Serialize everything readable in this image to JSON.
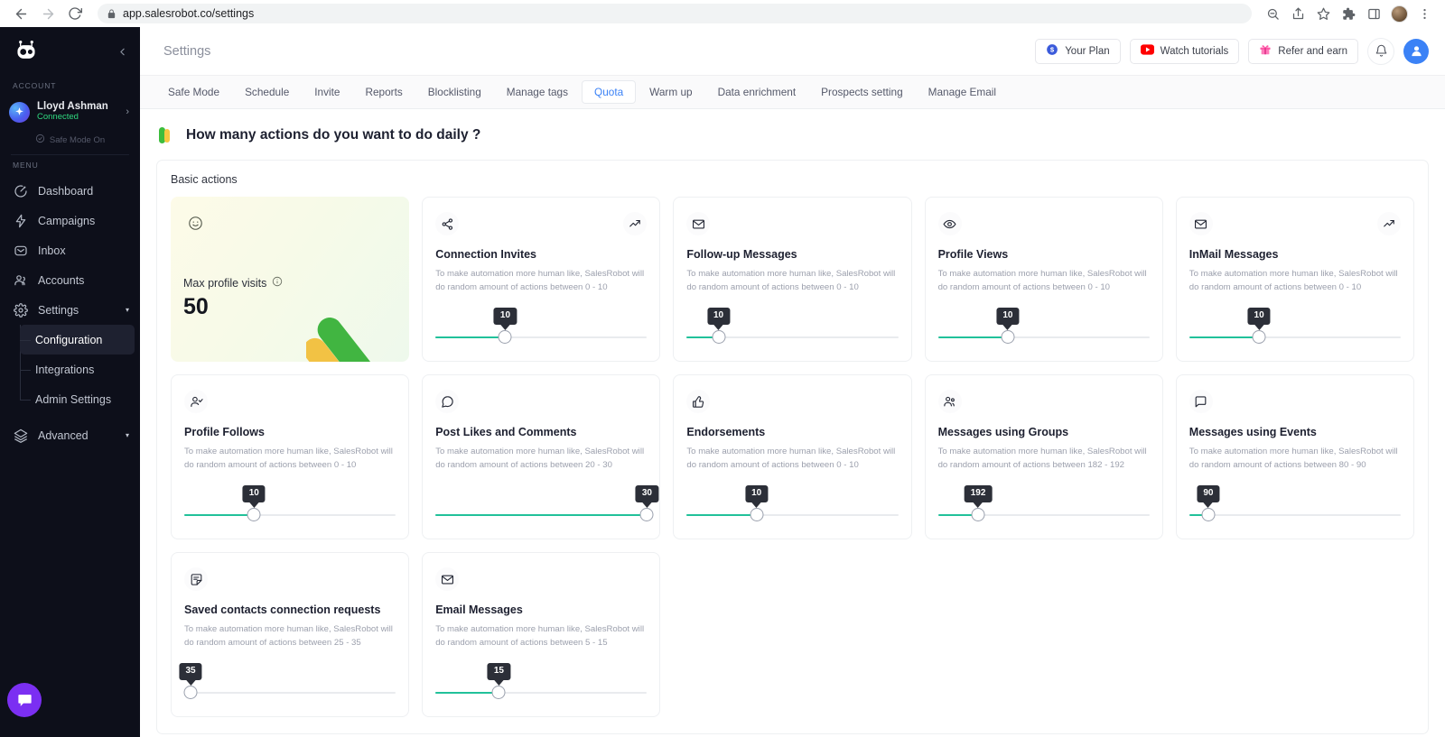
{
  "browser": {
    "url": "app.salesrobot.co/settings",
    "back_icon": "back-arrow-icon",
    "forward_icon": "forward-arrow-icon",
    "reload_icon": "reload-icon",
    "lock_icon": "lock-icon",
    "toolbar_icons": [
      "zoom-out-icon",
      "share-icon",
      "bookmark-star-icon",
      "extensions-puzzle-icon",
      "side-panel-icon",
      "profile-avatar-icon",
      "chrome-menu-icon"
    ]
  },
  "sidebar": {
    "logo_name": "salesrobot-logo",
    "collapse_icon": "chevron-left-icon",
    "account_heading": "ACCOUNT",
    "account": {
      "name": "Lloyd Ashman",
      "status": "Connected",
      "safe_mode": "Safe Mode On",
      "chevron": "›"
    },
    "menu_heading": "MENU",
    "items": [
      {
        "label": "Dashboard",
        "icon": "dashboard-icon",
        "caret": ""
      },
      {
        "label": "Campaigns",
        "icon": "campaigns-bolt-icon",
        "caret": ""
      },
      {
        "label": "Inbox",
        "icon": "inbox-envelope-icon",
        "caret": ""
      },
      {
        "label": "Accounts",
        "icon": "accounts-users-icon",
        "caret": ""
      },
      {
        "label": "Settings",
        "icon": "settings-gear-icon",
        "caret": "▾"
      }
    ],
    "submenu": [
      {
        "label": "Configuration",
        "active": true
      },
      {
        "label": "Integrations",
        "active": false
      },
      {
        "label": "Admin Settings",
        "active": false
      }
    ],
    "advanced": {
      "label": "Advanced",
      "icon": "layers-icon",
      "caret": "▾"
    },
    "chat_icon": "chat-bubble-icon"
  },
  "header": {
    "title": "Settings",
    "your_plan": "Your Plan",
    "watch_tutorials": "Watch tutorials",
    "refer_and_earn": "Refer and earn",
    "bell_icon": "notification-bell-icon",
    "avatar_icon": "user-avatar-icon"
  },
  "tabs": [
    {
      "label": "Safe Mode",
      "active": false
    },
    {
      "label": "Schedule",
      "active": false
    },
    {
      "label": "Invite",
      "active": false
    },
    {
      "label": "Reports",
      "active": false
    },
    {
      "label": "Blocklisting",
      "active": false
    },
    {
      "label": "Manage tags",
      "active": false
    },
    {
      "label": "Quota",
      "active": true
    },
    {
      "label": "Warm up",
      "active": false
    },
    {
      "label": "Data enrichment",
      "active": false
    },
    {
      "label": "Prospects setting",
      "active": false
    },
    {
      "label": "Manage Email",
      "active": false
    }
  ],
  "headline": "How many actions do you want to do daily ?",
  "panel": {
    "title": "Basic actions"
  },
  "hero_card": {
    "icon": "smiley-face-icon",
    "label": "Max profile visits",
    "info_icon": "info-circle-icon",
    "value": "50"
  },
  "cards": [
    {
      "title": "Connection Invites",
      "desc": "To make automation more human like, SalesRobot will do random amount of actions between 0 - 10",
      "icon": "share-nodes-icon",
      "corner_icon": "trend-up-icon",
      "value": "10",
      "percent": 33
    },
    {
      "title": "Follow-up Messages",
      "desc": "To make automation more human like, SalesRobot will do random amount of actions between 0 - 10",
      "icon": "envelope-icon",
      "corner_icon": "",
      "value": "10",
      "percent": 15
    },
    {
      "title": "Profile Views",
      "desc": "To make automation more human like, SalesRobot will do random amount of actions between 0 - 10",
      "icon": "eye-icon",
      "corner_icon": "",
      "value": "10",
      "percent": 33
    },
    {
      "title": "InMail Messages",
      "desc": "To make automation more human like, SalesRobot will do random amount of actions between 0 - 10",
      "icon": "envelope-icon",
      "corner_icon": "trend-up-icon",
      "value": "10",
      "percent": 33
    },
    {
      "title": "Profile Follows",
      "desc": "To make automation more human like, SalesRobot will do random amount of actions between 0 - 10",
      "icon": "user-check-icon",
      "corner_icon": "",
      "value": "10",
      "percent": 33
    },
    {
      "title": "Post Likes and Comments",
      "desc": "To make automation more human like, SalesRobot will do random amount of actions between 20 - 30",
      "icon": "comment-icon",
      "corner_icon": "",
      "value": "30",
      "percent": 100
    },
    {
      "title": "Endorsements",
      "desc": "To make automation more human like, SalesRobot will do random amount of actions between 0 - 10",
      "icon": "thumbs-up-icon",
      "corner_icon": "",
      "value": "10",
      "percent": 33
    },
    {
      "title": "Messages using Groups",
      "desc": "To make automation more human like, SalesRobot will do random amount of actions between 182 - 192",
      "icon": "group-users-icon",
      "corner_icon": "",
      "value": "192",
      "percent": 19
    },
    {
      "title": "Messages using Events",
      "desc": "To make automation more human like, SalesRobot will do random amount of actions between 80 - 90",
      "icon": "chat-square-icon",
      "corner_icon": "",
      "value": "90",
      "percent": 9
    },
    {
      "title": "Saved contacts connection requests",
      "desc": "To make automation more human like, SalesRobot will do random amount of actions between 25 - 35",
      "icon": "note-icon",
      "corner_icon": "",
      "value": "35",
      "percent": 3
    },
    {
      "title": "Email Messages",
      "desc": "To make automation more human like, SalesRobot will do random amount of actions between 5 - 15",
      "icon": "envelope-icon",
      "corner_icon": "",
      "value": "15",
      "percent": 30
    }
  ],
  "colors": {
    "accent_blue": "#3b82f6",
    "slider_green": "#21c19a",
    "sidebar_bg": "#0d0f1a",
    "connected_green": "#2fd97f",
    "chat_purple": "#7b2ff2",
    "badge_dark": "#2c2f38"
  }
}
